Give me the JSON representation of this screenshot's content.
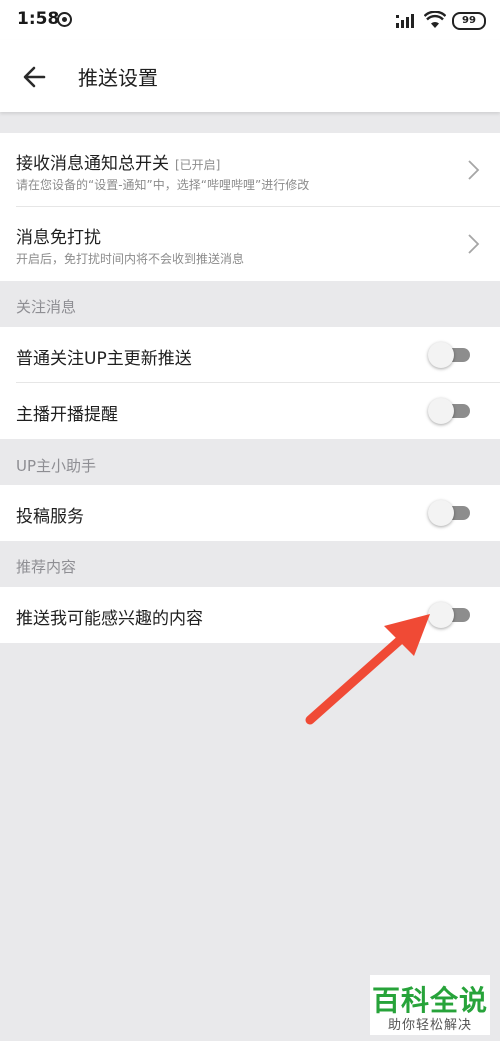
{
  "status_bar": {
    "time": "1:58",
    "battery": "99",
    "app_icon": "netease-music-icon",
    "signal_icon": "signal-bars-icon",
    "wifi_icon": "wifi-icon"
  },
  "header": {
    "back_icon": "arrow-left-icon",
    "title": "推送设置"
  },
  "settings": {
    "master": {
      "title": "接收消息通知总开关",
      "tag": "[已开启]",
      "subtitle": "请在您设备的“设置-通知”中，选择“哔哩哔哩”进行修改",
      "icon": "chevron-right-icon"
    },
    "dnd": {
      "title": "消息免打扰",
      "subtitle": "开启后，免打扰时间内将不会收到推送消息",
      "icon": "chevron-right-icon"
    }
  },
  "sections": {
    "follow": {
      "header": "关注消息",
      "items": [
        {
          "label": "普通关注UP主更新推送",
          "enabled": false
        },
        {
          "label": "主播开播提醒",
          "enabled": false
        }
      ]
    },
    "up_helper": {
      "header": "UP主小助手",
      "items": [
        {
          "label": "投稿服务",
          "enabled": false
        }
      ]
    },
    "recommend": {
      "header": "推荐内容",
      "items": [
        {
          "label": "推送我可能感兴趣的内容",
          "enabled": false
        }
      ]
    }
  },
  "annotation": {
    "arrow_color": "#f04a35",
    "icon": "red-arrow-icon"
  },
  "watermark": {
    "main": "百科全说",
    "sub": "助你轻松解决",
    "color": "#27a33a"
  },
  "colors": {
    "background": "#e9e9eb",
    "card": "#ffffff",
    "toggle_track_off": "#8d8d8d",
    "secondary_text": "#8c8c8c"
  }
}
